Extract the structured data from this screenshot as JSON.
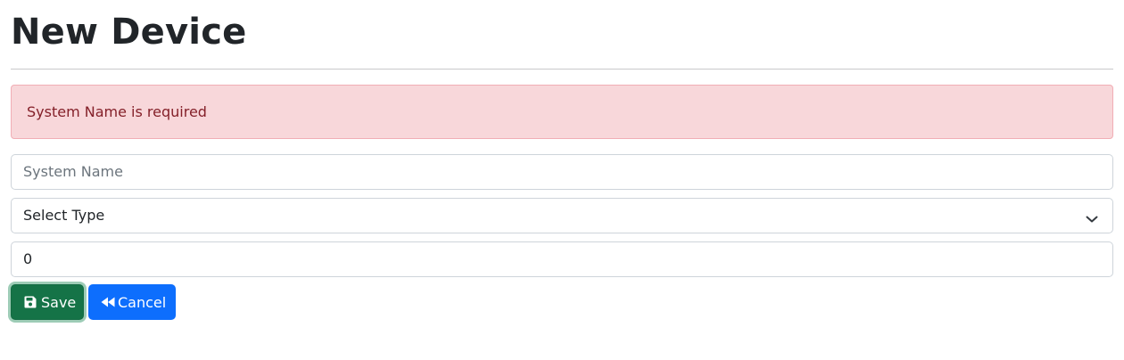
{
  "page": {
    "title": "New Device"
  },
  "alert": {
    "message": "System Name is required",
    "color": "#842029",
    "background": "#f8d7da"
  },
  "form": {
    "system_name": {
      "value": "",
      "placeholder": "System Name"
    },
    "type_select": {
      "selected": "Select Type",
      "icon": "chevron-down-icon"
    },
    "number_field": {
      "value": "0"
    }
  },
  "actions": {
    "save": {
      "label": "Save",
      "icon": "save-icon",
      "color": "#157347"
    },
    "cancel": {
      "label": "Cancel",
      "icon": "backward-icon",
      "color": "#0d6efd"
    }
  }
}
